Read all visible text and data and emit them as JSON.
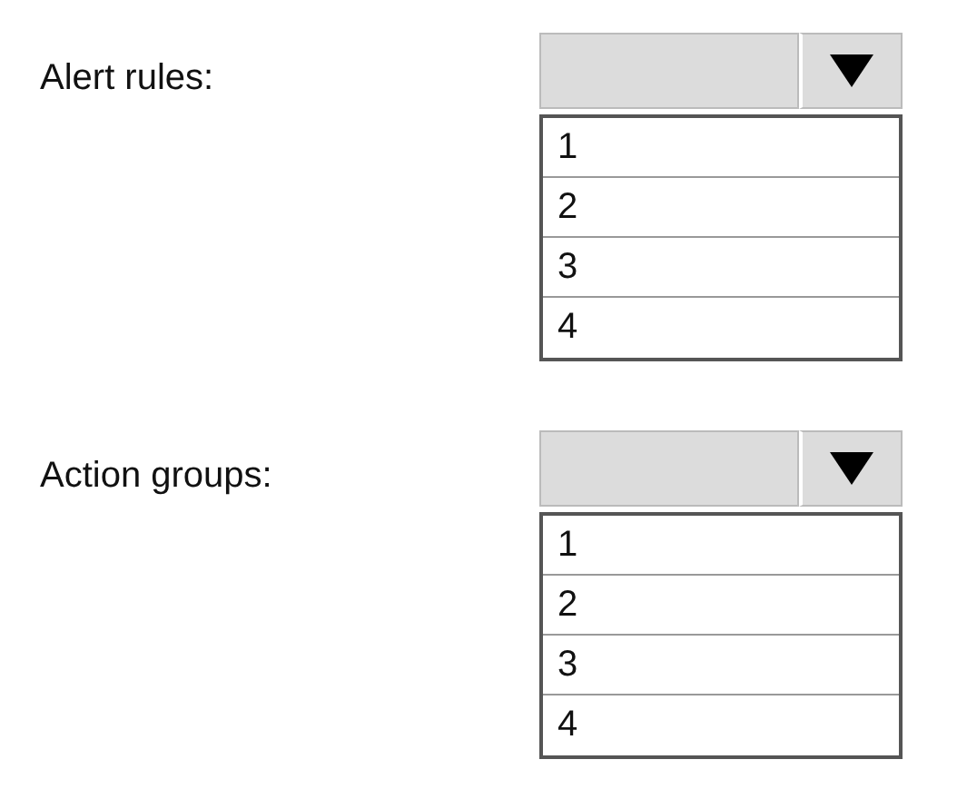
{
  "questions": [
    {
      "label": "Alert rules:",
      "options": [
        "1",
        "2",
        "3",
        "4"
      ]
    },
    {
      "label": "Action groups:",
      "options": [
        "1",
        "2",
        "3",
        "4"
      ]
    }
  ]
}
